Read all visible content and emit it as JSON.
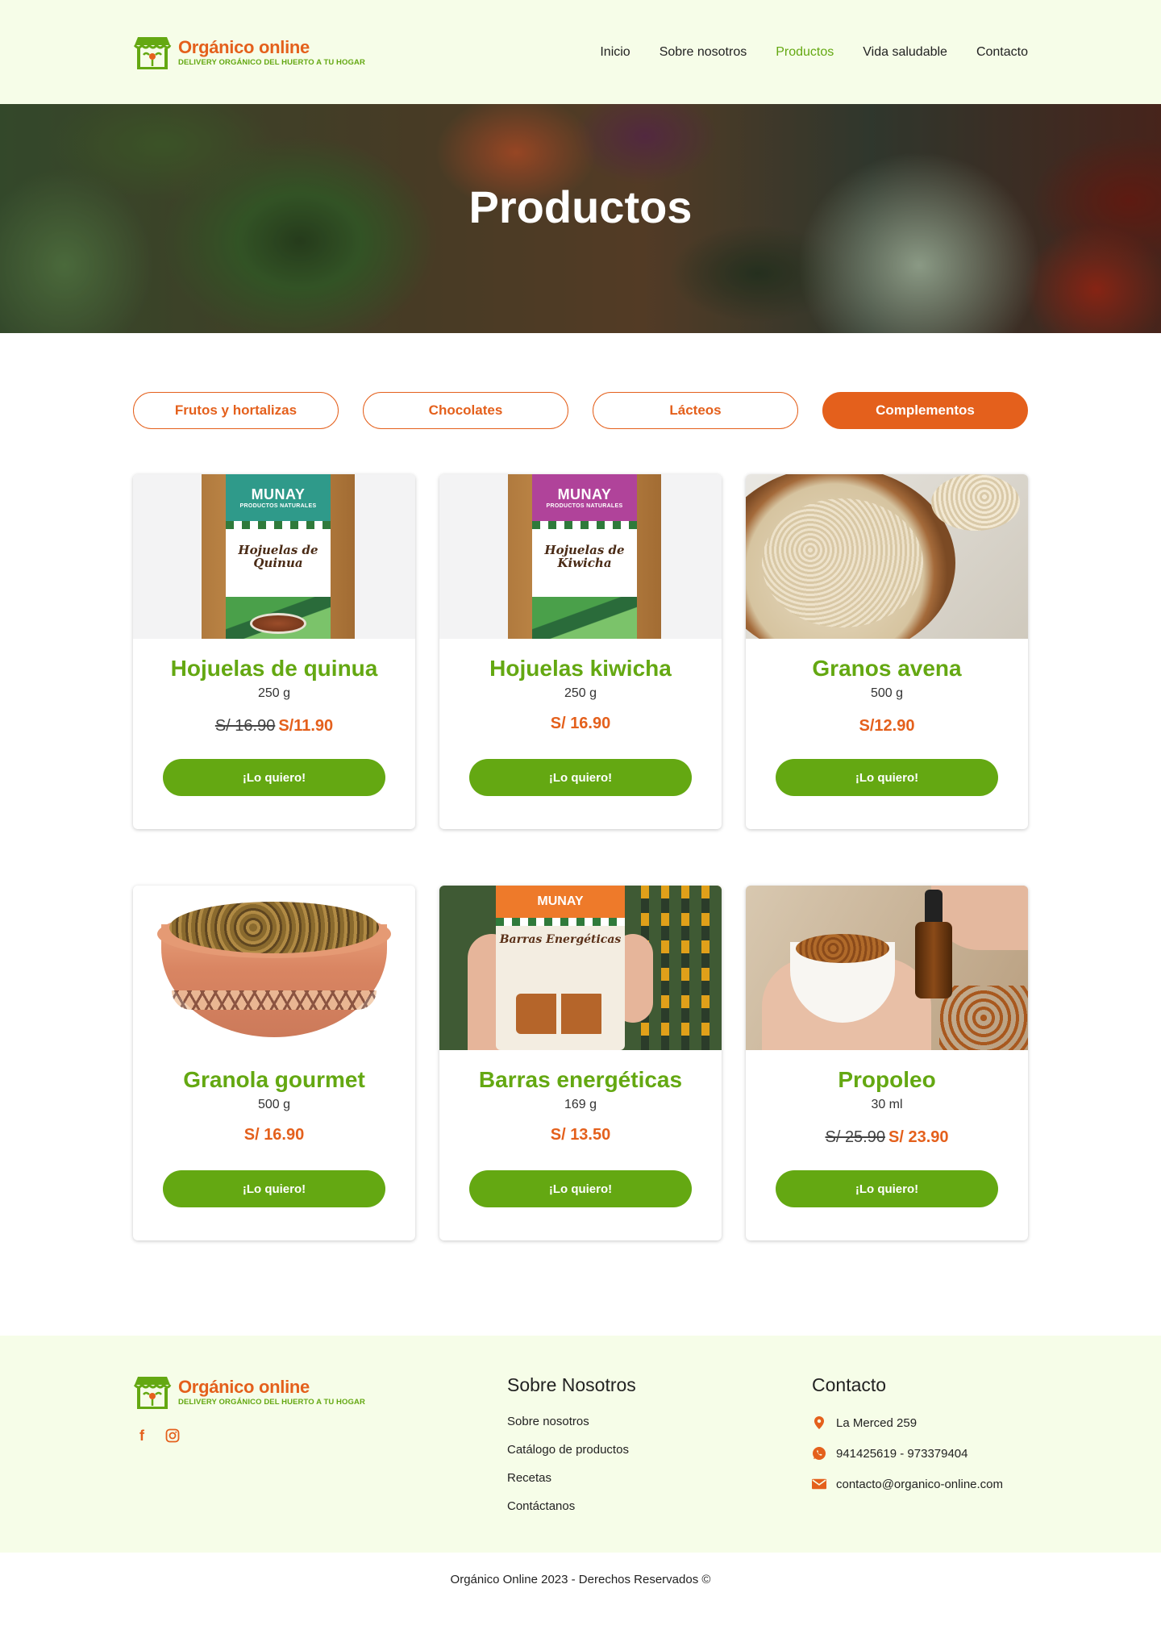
{
  "brand": {
    "name": "Orgánico online",
    "tagline": "DELIVERY ORGÁNICO DEL HUERTO A TU HOGAR",
    "colors": {
      "orange": "#e4601c",
      "green": "#64a812",
      "light_bg": "#f6fde8"
    }
  },
  "nav": {
    "items": [
      {
        "label": "Inicio"
      },
      {
        "label": "Sobre nosotros"
      },
      {
        "label": "Productos",
        "active": true
      },
      {
        "label": "Vida saludable"
      },
      {
        "label": "Contacto"
      }
    ]
  },
  "hero": {
    "title": "Productos"
  },
  "categories": [
    {
      "label": "Frutos y hortalizas"
    },
    {
      "label": "Chocolates"
    },
    {
      "label": "Lácteos"
    },
    {
      "label": "Complementos",
      "active": true
    }
  ],
  "products": [
    {
      "name": "Hojuelas de quinua",
      "qty": "250 g",
      "old_price": "S/ 16.90",
      "price": "S/11.90",
      "button": "¡Lo quiero!",
      "image": "quinua-pouch",
      "pouch": {
        "brand": "MUNAY",
        "sub": "PRODUCTOS NATURALES",
        "name": "Hojuelas de Quinua"
      }
    },
    {
      "name": "Hojuelas kiwicha",
      "qty": "250 g",
      "old_price": "",
      "price": "S/ 16.90",
      "button": "¡Lo quiero!",
      "image": "kiwicha-pouch",
      "pouch": {
        "brand": "MUNAY",
        "sub": "PRODUCTOS NATURALES",
        "name": "Hojuelas de Kiwicha"
      }
    },
    {
      "name": "Granos avena",
      "qty": "500 g",
      "old_price": "",
      "price": "S/12.90",
      "button": "¡Lo quiero!",
      "image": "oats-bowl"
    },
    {
      "name": "Granola gourmet",
      "qty": "500 g",
      "old_price": "",
      "price": "S/ 16.90",
      "button": "¡Lo quiero!",
      "image": "granola-bowl"
    },
    {
      "name": "Barras energéticas",
      "qty": "169 g",
      "old_price": "",
      "price": "S/ 13.50",
      "button": "¡Lo quiero!",
      "image": "energy-bars-pack",
      "pouch": {
        "brand": "MUNAY",
        "name": "Barras Energéticas"
      }
    },
    {
      "name": "Propoleo",
      "qty": "30 ml",
      "old_price": "S/ 25.90",
      "price": "S/ 23.90",
      "button": "¡Lo quiero!",
      "image": "propolis-cup"
    }
  ],
  "footer": {
    "social": [
      {
        "icon": "facebook-icon",
        "glyph": "f"
      },
      {
        "icon": "instagram-icon",
        "glyph": "◎"
      }
    ],
    "about": {
      "title": "Sobre Nosotros",
      "links": [
        "Sobre nosotros",
        "Catálogo de productos",
        "Recetas",
        "Contáctanos"
      ]
    },
    "contact": {
      "title": "Contacto",
      "address": "La Merced 259",
      "phones": "941425619 - 973379404",
      "email": "contacto@organico-online.com"
    },
    "copyright": "Orgánico Online 2023 - Derechos Reservados ©"
  }
}
